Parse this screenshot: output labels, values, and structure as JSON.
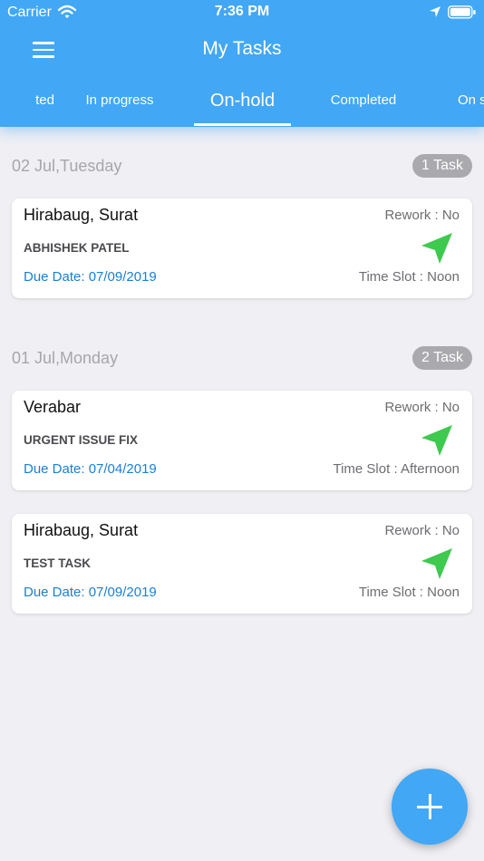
{
  "status_bar": {
    "carrier": "Carrier",
    "time": "7:36 PM",
    "wifi_icon": "wifi-icon",
    "location_icon": "location-arrow-icon",
    "battery_icon": "battery-icon"
  },
  "nav": {
    "title": "My Tasks",
    "menu_icon": "hamburger-menu-icon"
  },
  "tabs": [
    {
      "label": "ted"
    },
    {
      "label": "In progress"
    },
    {
      "label": "On-hold",
      "active": true
    },
    {
      "label": "Completed"
    },
    {
      "label": "On s"
    }
  ],
  "sections": [
    {
      "date": "02 Jul,Tuesday",
      "count": "1 Task",
      "tasks": [
        {
          "location": "Hirabaug, Surat",
          "rework": "Rework : No",
          "name": "ABHISHEK PATEL",
          "due": "Due Date: 07/09/2019",
          "slot": "Time Slot : Noon"
        }
      ]
    },
    {
      "date": "01 Jul,Monday",
      "count": "2 Task",
      "tasks": [
        {
          "location": "Verabar",
          "rework": "Rework : No",
          "name": "URGENT ISSUE FIX",
          "due": "Due Date: 07/04/2019",
          "slot": "Time Slot : Afternoon"
        },
        {
          "location": "Hirabaug, Surat",
          "rework": "Rework : No",
          "name": "TEST TASK",
          "due": "Due Date: 07/09/2019",
          "slot": "Time Slot : Noon"
        }
      ]
    }
  ],
  "fab": {
    "icon": "plus-icon"
  },
  "colors": {
    "primary": "#42a7f5",
    "background": "#efeff4",
    "due_date": "#1a7fd4",
    "navigate": "#3ec94f",
    "pill": "#a9a9ae"
  }
}
